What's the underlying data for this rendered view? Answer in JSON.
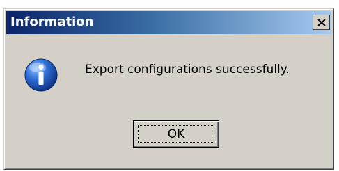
{
  "dialog": {
    "title": "Information",
    "close_icon": "close-icon",
    "icon": "information-icon",
    "message": "Export configurations successfully.",
    "ok_label": "OK"
  },
  "colors": {
    "titlebar_start": "#0a246a",
    "titlebar_end": "#a6caf0",
    "window_face": "#d4d0c8",
    "icon_blue": "#1f5fbf"
  }
}
